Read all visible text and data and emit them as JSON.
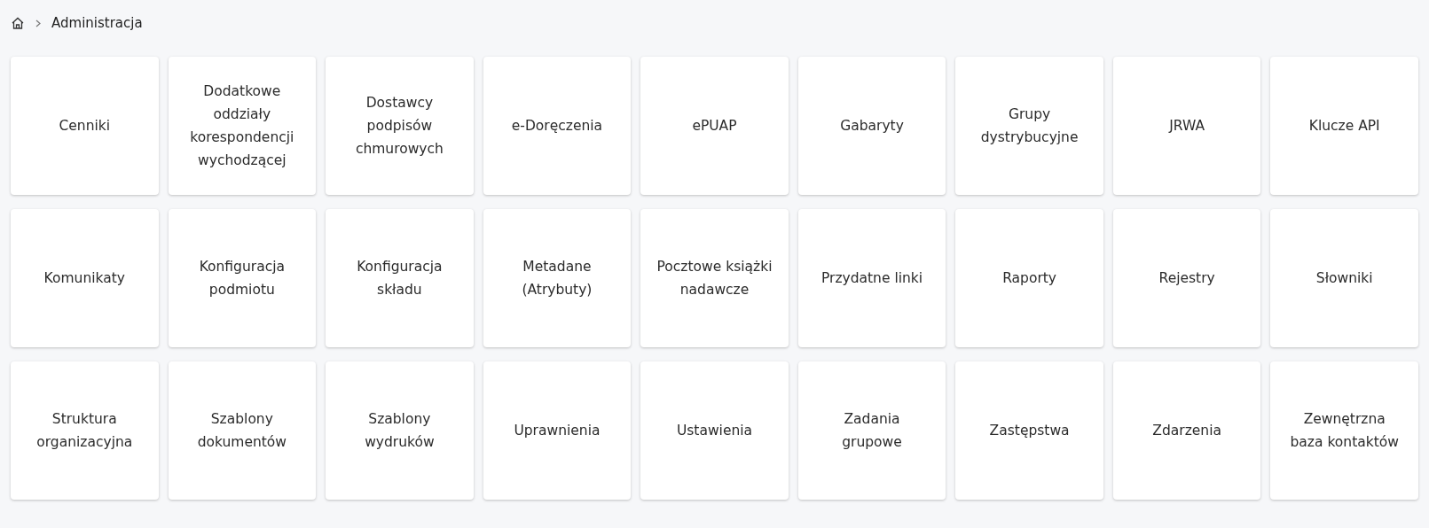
{
  "breadcrumb": {
    "items": [
      "Administracja"
    ]
  },
  "tiles": [
    {
      "label": "Cenniki"
    },
    {
      "label": "Dodatkowe\noddziały\nkorespondencji\nwychodzącej"
    },
    {
      "label": "Dostawcy\npodpisów\nchmurowych"
    },
    {
      "label": "e-Doręczenia"
    },
    {
      "label": "ePUAP"
    },
    {
      "label": "Gabaryty"
    },
    {
      "label": "Grupy\ndystrybucyjne"
    },
    {
      "label": "JRWA"
    },
    {
      "label": "Klucze API"
    },
    {
      "label": "Komunikaty"
    },
    {
      "label": "Konfiguracja\npodmiotu"
    },
    {
      "label": "Konfiguracja\nskładu"
    },
    {
      "label": "Metadane\n(Atrybuty)"
    },
    {
      "label": "Pocztowe książki\nnadawcze"
    },
    {
      "label": "Przydatne linki"
    },
    {
      "label": "Raporty"
    },
    {
      "label": "Rejestry"
    },
    {
      "label": "Słowniki"
    },
    {
      "label": "Struktura\norganizacyjna"
    },
    {
      "label": "Szablony\ndokumentów"
    },
    {
      "label": "Szablony\nwydruków"
    },
    {
      "label": "Uprawnienia"
    },
    {
      "label": "Ustawienia"
    },
    {
      "label": "Zadania\ngrupowe"
    },
    {
      "label": "Zastępstwa"
    },
    {
      "label": "Zdarzenia"
    },
    {
      "label": "Zewnętrzna\nbaza kontaktów"
    }
  ]
}
